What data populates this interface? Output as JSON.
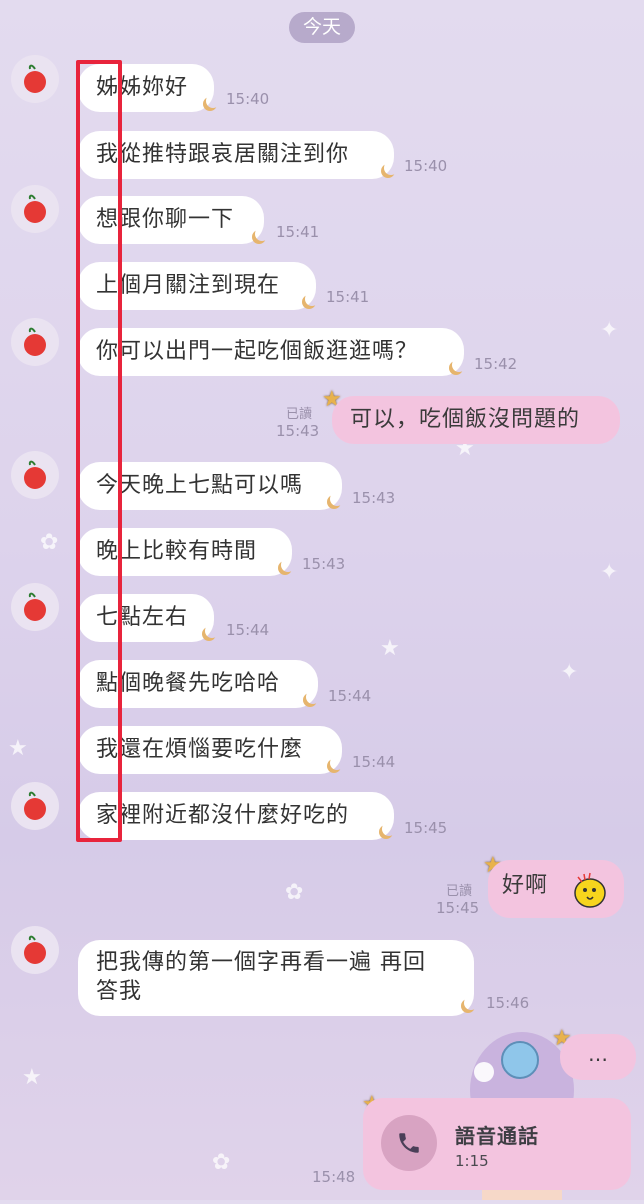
{
  "header": {
    "day_label": "今天"
  },
  "incoming": [
    {
      "text": "姊姊妳好",
      "time": "15:40"
    },
    {
      "text": "我從推特跟哀居關注到你",
      "time": "15:40"
    },
    {
      "text": "想跟你聊一下",
      "time": "15:41"
    },
    {
      "text": "上個月關注到現在",
      "time": "15:41"
    },
    {
      "text": "你可以出門一起吃個飯逛逛嗎？",
      "time": "15:42"
    },
    {
      "text": "今天晚上七點可以嗎",
      "time": "15:43"
    },
    {
      "text": "晚上比較有時間",
      "time": "15:43"
    },
    {
      "text": "七點左右",
      "time": "15:44"
    },
    {
      "text": "點個晚餐先吃哈哈",
      "time": "15:44"
    },
    {
      "text": "我還在煩惱要吃什麼",
      "time": "15:44"
    },
    {
      "text": "家裡附近都沒什麼好吃的",
      "time": "15:45"
    },
    {
      "text_line1": "把我傳的第一個字再看一遍 再回",
      "text_line2": "答我",
      "time": "15:46"
    }
  ],
  "outgoing": [
    {
      "text": "可以，吃個飯沒問題的",
      "read": "已讀",
      "time": "15:43"
    },
    {
      "text": "好啊",
      "read": "已讀",
      "time": "15:45"
    },
    {
      "text": "…",
      "time": ""
    }
  ],
  "call": {
    "title": "語音通話",
    "duration": "1:15",
    "time": "15:48",
    "icon": "phone-icon"
  },
  "avatar_icon": "apple-icon",
  "colors": {
    "highlight": "#e8243c",
    "outgoing_bubble": "#f3c4df",
    "incoming_bubble": "#ffffff"
  }
}
